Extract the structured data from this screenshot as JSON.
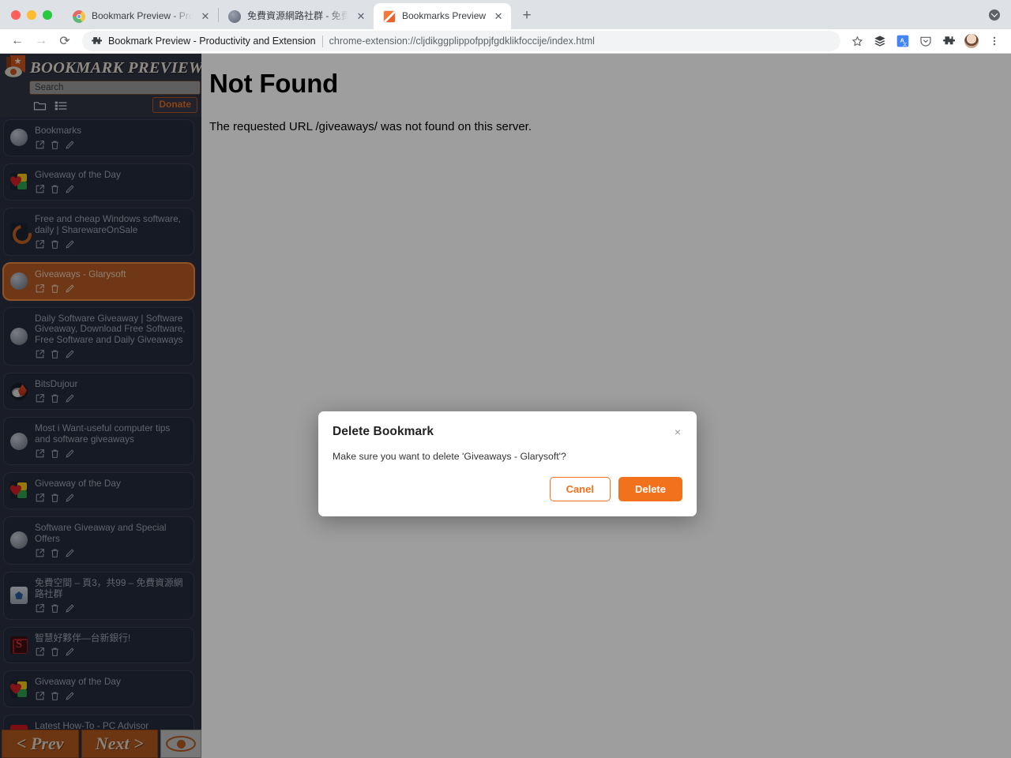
{
  "browser": {
    "tabs": [
      {
        "title": "Bookmark Preview - Productivity and Extension",
        "favicon": "chrome-icon",
        "active": false
      },
      {
        "title": "免費資源網路社群 - 免費資源指南",
        "favicon": "globe-icon",
        "active": false
      },
      {
        "title": "Bookmarks Preview",
        "favicon": "extension-icon",
        "active": true
      }
    ],
    "new_tab_label": "+",
    "nav": {
      "back": "←",
      "forward": "→",
      "reload": "⟳"
    },
    "omnibox": {
      "extension_name": "Bookmark Preview - Productivity and Extension",
      "url": "chrome-extension://cljdikggplippofppjfgdklikfoccije/index.html"
    },
    "toolbar_icons": [
      "bookmark-star-icon",
      "layers-icon",
      "translate-icon",
      "pocket-icon",
      "puzzle-extensions-icon",
      "profile-avatar",
      "chrome-menu-icon"
    ]
  },
  "sidebar": {
    "title": "BOOKMARK PREVIEW",
    "search_placeholder": "Search",
    "search_value": "",
    "tools": [
      "folder-icon",
      "list-view-icon"
    ],
    "donate_label": "Donate",
    "items": [
      {
        "title": "Bookmarks",
        "favicon": "globe",
        "selected": false
      },
      {
        "title": "Giveaway of the Day",
        "favicon": "gotd",
        "selected": false
      },
      {
        "title": "Free and cheap Windows software, daily | SharewareOnSale",
        "favicon": "sos",
        "selected": false
      },
      {
        "title": "Giveaways - Glarysoft",
        "favicon": "globe",
        "selected": true
      },
      {
        "title": "Daily Software Giveaway | Software Giveaway, Download Free Software, Free Software and Daily Giveaways",
        "favicon": "globe",
        "selected": false
      },
      {
        "title": "BitsDujour",
        "favicon": "bits",
        "selected": false
      },
      {
        "title": "Most i Want-useful computer tips and software giveaways",
        "favicon": "globe",
        "selected": false
      },
      {
        "title": "Giveaway of the Day",
        "favicon": "gotd",
        "selected": false
      },
      {
        "title": "Software Giveaway and Special Offers",
        "favicon": "globe",
        "selected": false
      },
      {
        "title": "免費空間 – 頁3，共99 – 免費資源網路社群",
        "favicon": "cn",
        "selected": false
      },
      {
        "title": "智慧好夥伴—台新銀行!",
        "favicon": "ts",
        "selected": false
      },
      {
        "title": "Giveaway of the Day",
        "favicon": "gotd",
        "selected": false
      },
      {
        "title": "Latest How-To - PC Advisor",
        "favicon": "ta",
        "selected": false
      }
    ],
    "item_actions": [
      "open-in-new-icon",
      "trash-icon",
      "edit-pencil-icon"
    ],
    "footer": {
      "prev_label": "< Prev",
      "next_label": "Next >",
      "preview_toggle": "eye-icon"
    }
  },
  "content": {
    "heading": "Not Found",
    "message": "The requested URL /giveaways/ was not found on this server."
  },
  "modal": {
    "title": "Delete Bookmark",
    "close_label": "×",
    "message": "Make sure you want to delete 'Giveaways - Glarysoft'?",
    "cancel_label": "Canel",
    "confirm_label": "Delete"
  },
  "colors": {
    "accent_orange": "#f2711c",
    "sidebar_bg": "#2b3040",
    "selected_item": "#b45a22",
    "footer_button": "#b1571f"
  }
}
